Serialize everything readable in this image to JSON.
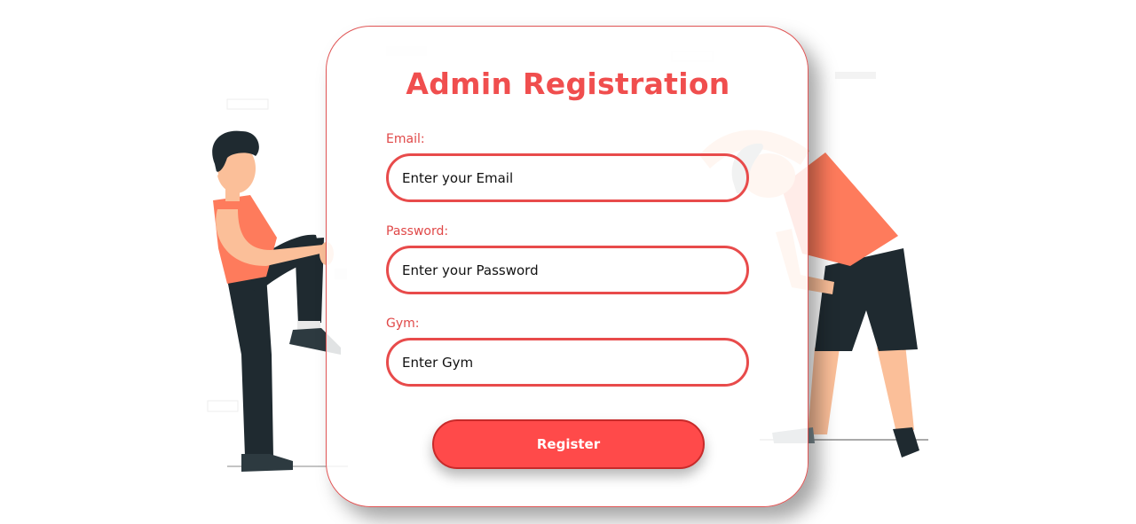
{
  "form": {
    "title": "Admin Registration",
    "email_label": "Email:",
    "email_placeholder": "Enter your Email",
    "password_label": "Password:",
    "password_placeholder": "Enter your Password",
    "gym_label": "Gym:",
    "gym_placeholder": "Enter Gym",
    "submit_label": "Register"
  },
  "colors": {
    "accent": "#f04e4e",
    "button": "#ff4a4a",
    "shirt": "#fe7b5c",
    "pants": "#1f2a30",
    "skin": "#fbbf99"
  },
  "icons": [
    "person-stretching-left-illustration",
    "person-stretching-right-illustration"
  ]
}
